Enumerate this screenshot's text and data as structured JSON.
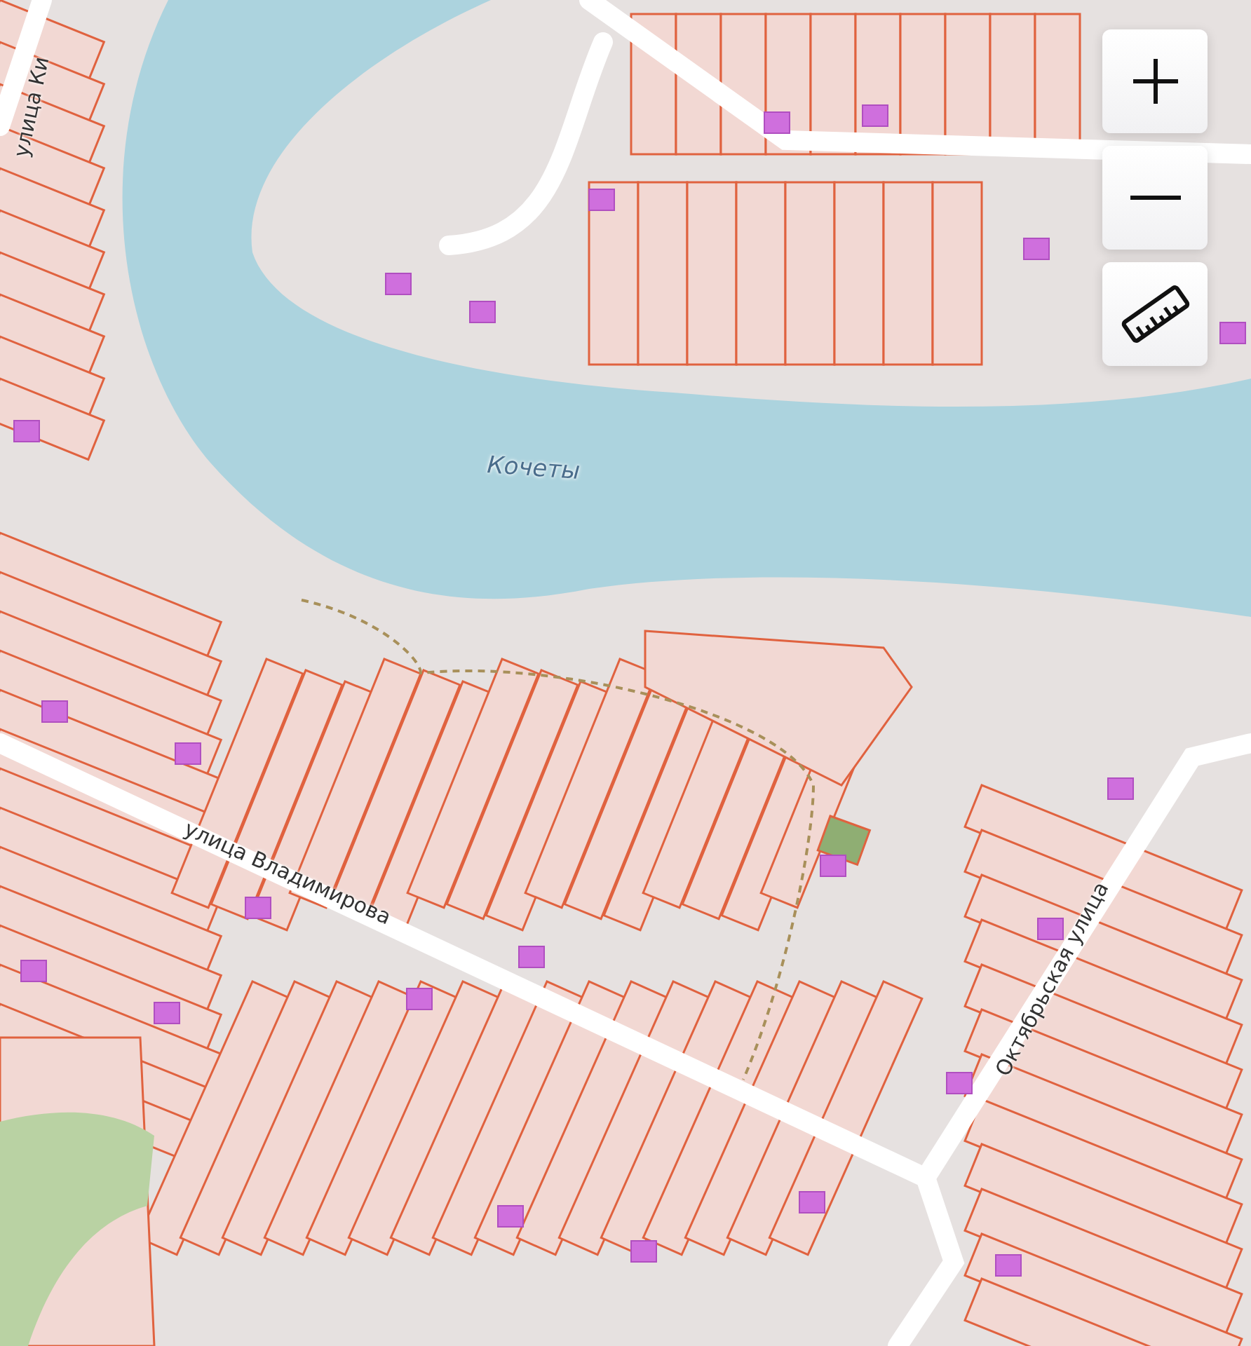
{
  "map": {
    "labels": [
      {
        "kind": "street",
        "text": "улица Ки"
      },
      {
        "kind": "water",
        "text": "Кочеты"
      },
      {
        "kind": "street",
        "text": "улица Владимирова"
      },
      {
        "kind": "street",
        "text": "Октябрьская улица"
      }
    ]
  },
  "controls": [
    {
      "kind": "zoom_in"
    },
    {
      "kind": "zoom_out"
    },
    {
      "kind": "ruler"
    }
  ]
}
